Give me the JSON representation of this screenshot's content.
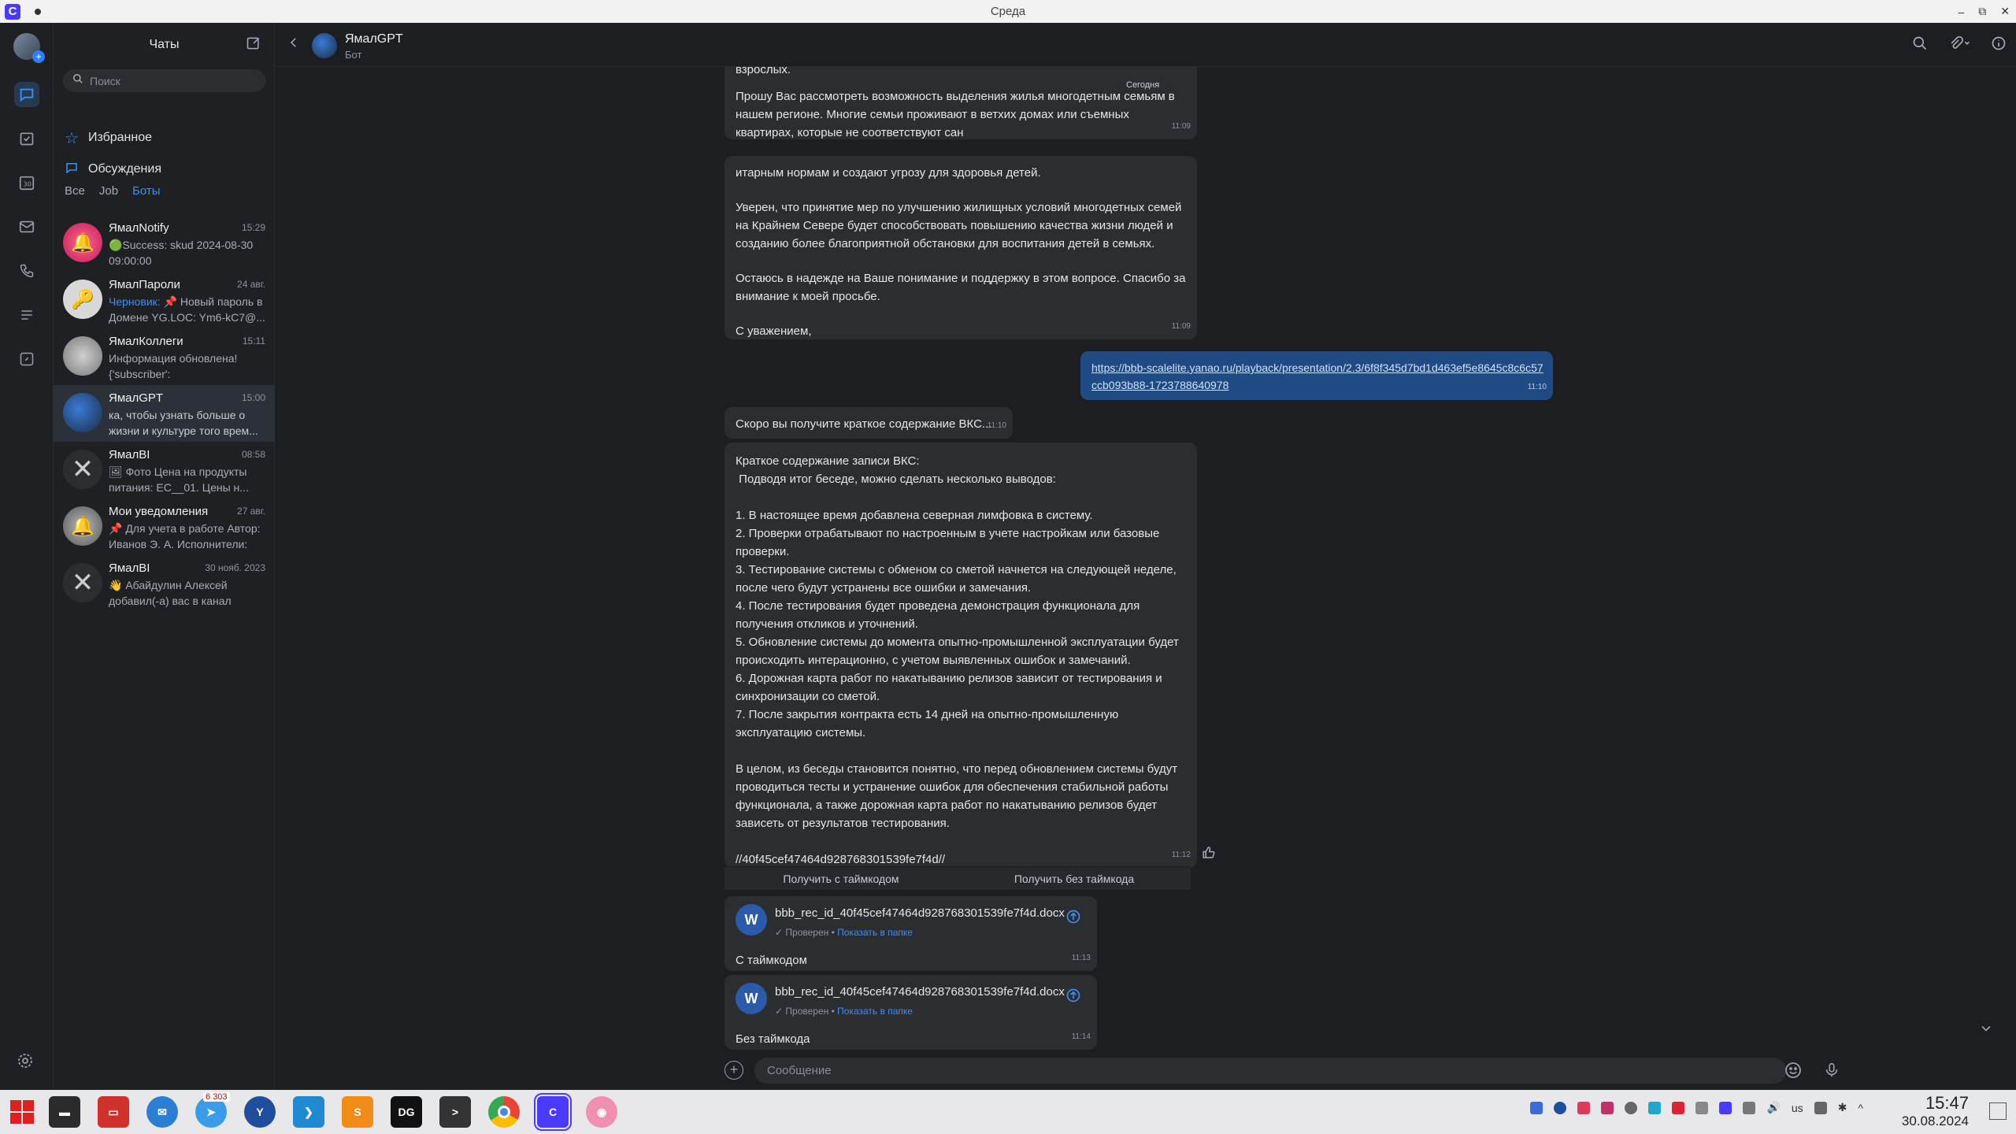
{
  "window": {
    "title": "Среда",
    "logo_letter": "C"
  },
  "sidebar": {
    "header": "Чаты",
    "search_placeholder": "Поиск",
    "nav": [
      {
        "label": "Избранное"
      },
      {
        "label": "Обсуждения"
      }
    ],
    "tabs": [
      "Все",
      "Job",
      "Боты"
    ],
    "chats": [
      {
        "name": "ЯмалNotify",
        "time": "15:29",
        "preview": "🟢Success: skud 2024-08-30 09:00:00"
      },
      {
        "name": "ЯмалПароли",
        "time": "24 авг.",
        "draft": "Черновик:",
        "preview": "📌 Новый пароль в Домене YG.LOC: Ym6-kC7@..."
      },
      {
        "name": "ЯмалКоллеги",
        "time": "15:11",
        "preview": "Информация обновлена! {'subscriber': 'issafonov@yana..."
      },
      {
        "name": "ЯмалGPT",
        "time": "15:00",
        "preview": "ка, чтобы узнать больше о жизни и культуре того врем..."
      },
      {
        "name": "ЯмалBI",
        "time": "08:58",
        "preview": "🖼 Фото Цена на продукты питания: EC__01. Цены н..."
      },
      {
        "name": "Мои уведомления",
        "time": "27 авг.",
        "preview": "📌 Для учета в работе Автор: Иванов Э. А. Исполнители: С..."
      },
      {
        "name": "ЯмалBI",
        "time": "30 нояб. 2023",
        "preview": "👋 Абайдулин Алексей добавил(-а) вас в канал"
      }
    ]
  },
  "chat_header": {
    "name": "ЯмалGPT",
    "subtitle": "Бот"
  },
  "messages": {
    "m1_text_top": "взрослых.",
    "date_pill": "Сегодня",
    "m1_text": "Прошу Вас рассмотреть возможность выделения жилья многодетным семьям в нашем регионе. Многие семьи проживают в ветхих домах или съемных квартирах, которые не соответствуют сан",
    "m1_time": "11:09",
    "m2_p1": "итарным нормам и создают угрозу для здоровья детей.",
    "m2_p2": "Уверен, что принятие мер по улучшению жилищных условий многодетных семей на Крайнем Севере будет способствовать повышению качества жизни людей и созданию более благоприятной обстановки для воспитания детей в семьях.",
    "m2_p3": "Остаюсь в надежде на Ваше понимание и поддержку в этом вопросе. Спасибо за внимание к моей просьбе.",
    "m2_p4": "С уважением,",
    "m2_time": "11:09",
    "out_link": "https://bbb-scalelite.yanao.ru/playback/presentation/2.3/6f8f345d7bd1d463ef5e8645c8c6c57ccb093b88-1723788640978",
    "out_time": "11:10",
    "m3_text": "Скоро вы получите краткое содержание ВКС...",
    "m3_time": "11:10",
    "m4_lines": [
      "Краткое содержание записи ВКС:",
      " Подводя итог беседе, можно сделать несколько выводов:",
      "",
      "1. В настоящее время добавлена северная лимфовка в систему.",
      "2. Проверки отрабатывают по настроенным в учете настройкам или базовые проверки.",
      "3. Тестирование системы с обменом со сметой начнется на следующей неделе, после чего будут устранены все ошибки и замечания.",
      "4. После тестирования будет проведена демонстрация функционала для получения откликов и уточнений.",
      "5. Обновление системы до момента опытно-промышленной эксплуатации будет происходить интерационно, с учетом выявленных ошибок и замечаний.",
      "6. Дорожная карта работ по накатыванию релизов зависит от тестирования и синхронизации со сметой.",
      "7. После закрытия контракта есть 14 дней на опытно-промышленную эксплуатацию системы.",
      "",
      "В целом, из беседы становится понятно, что перед обновлением системы будут проводиться тесты и устранение ошибок для обеспечения стабильной работы функционала, а также дорожная карта работ по накатыванию релизов будет зависеть от результатов тестирования.",
      "",
      "//40f45cef47464d928768301539fe7f4d//"
    ],
    "m4_time": "11:12",
    "btn_with": "Получить с таймкодом",
    "btn_without": "Получить без таймкода",
    "files": [
      {
        "name": "bbb_rec_id_40f45cef47464d928768301539fe7f4d.docx",
        "status": "✓ Проверен •",
        "link": "Показать в папке",
        "caption": "С таймкодом",
        "time": "11:13"
      },
      {
        "name": "bbb_rec_id_40f45cef47464d928768301539fe7f4d.docx",
        "status": "✓ Проверен •",
        "link": "Показать в папке",
        "caption": "Без таймкода",
        "time": "11:14"
      }
    ]
  },
  "composer": {
    "placeholder": "Сообщение"
  },
  "taskbar": {
    "badge": "6 303",
    "lang": "us",
    "time": "15:47",
    "date": "30.08.2024"
  }
}
